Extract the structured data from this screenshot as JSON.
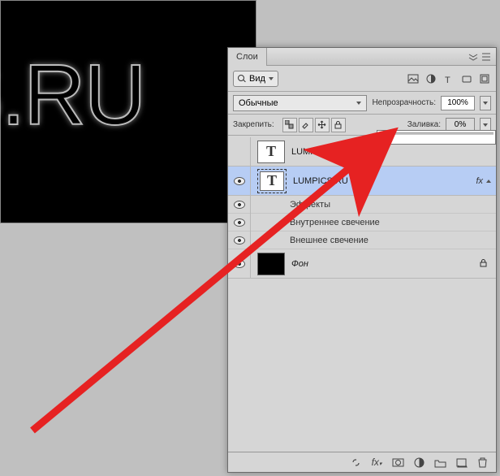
{
  "canvas": {
    "visible_text": "ICS.RU"
  },
  "panel": {
    "tab": "Слои",
    "filter_label": "Вид",
    "blend_mode": "Обычные",
    "opacity_label": "Непрозрачность:",
    "opacity_value": "100%",
    "lock_label": "Закрепить:",
    "fill_label": "Заливка:",
    "fill_value": "0%"
  },
  "layers": [
    {
      "name": "LUMPICS.RU копия",
      "visible": false,
      "type": "text",
      "selected": false
    },
    {
      "name": "LUMPICS.RU",
      "visible": true,
      "type": "text",
      "selected": true,
      "has_fx": true,
      "effects_header": "Эффекты",
      "effects": [
        "Внутреннее свечение",
        "Внешнее свечение"
      ]
    },
    {
      "name": "Фон",
      "visible": true,
      "type": "bg",
      "selected": false,
      "locked": true
    }
  ]
}
